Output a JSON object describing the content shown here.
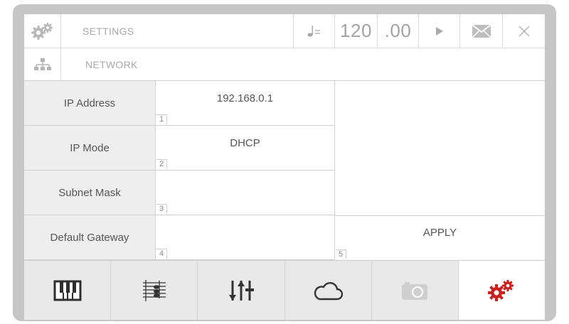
{
  "header": {
    "title": "SETTINGS",
    "tempo_icon": "quarter-note-equals-icon",
    "tempo_value": "120",
    "tempo_fraction": ".00",
    "play_icon": "play-icon",
    "mail_icon": "envelope-icon",
    "close_icon": "close-icon",
    "settings_icon": "gears-icon"
  },
  "subheader": {
    "title": "NETWORK",
    "icon": "network-tree-icon"
  },
  "fields": [
    {
      "label": "IP Address",
      "value": "192.168.0.1",
      "index": "1"
    },
    {
      "label": "IP Mode",
      "value": "DHCP",
      "index": "2"
    },
    {
      "label": "Subnet Mask",
      "value": "",
      "index": "3"
    },
    {
      "label": "Default Gateway",
      "value": "",
      "index": "4"
    }
  ],
  "apply": {
    "label": "APPLY",
    "index": "5"
  },
  "bottom_nav": [
    {
      "name": "piano-keys-icon"
    },
    {
      "name": "sheet-music-icon"
    },
    {
      "name": "mixer-sliders-icon"
    },
    {
      "name": "cloud-icon"
    },
    {
      "name": "camera-icon"
    },
    {
      "name": "settings-gears-icon",
      "active": true
    }
  ],
  "colors": {
    "active": "#cc1f1f",
    "dark_icon": "#3a3a3a",
    "muted_icon": "#c4c4c4"
  }
}
